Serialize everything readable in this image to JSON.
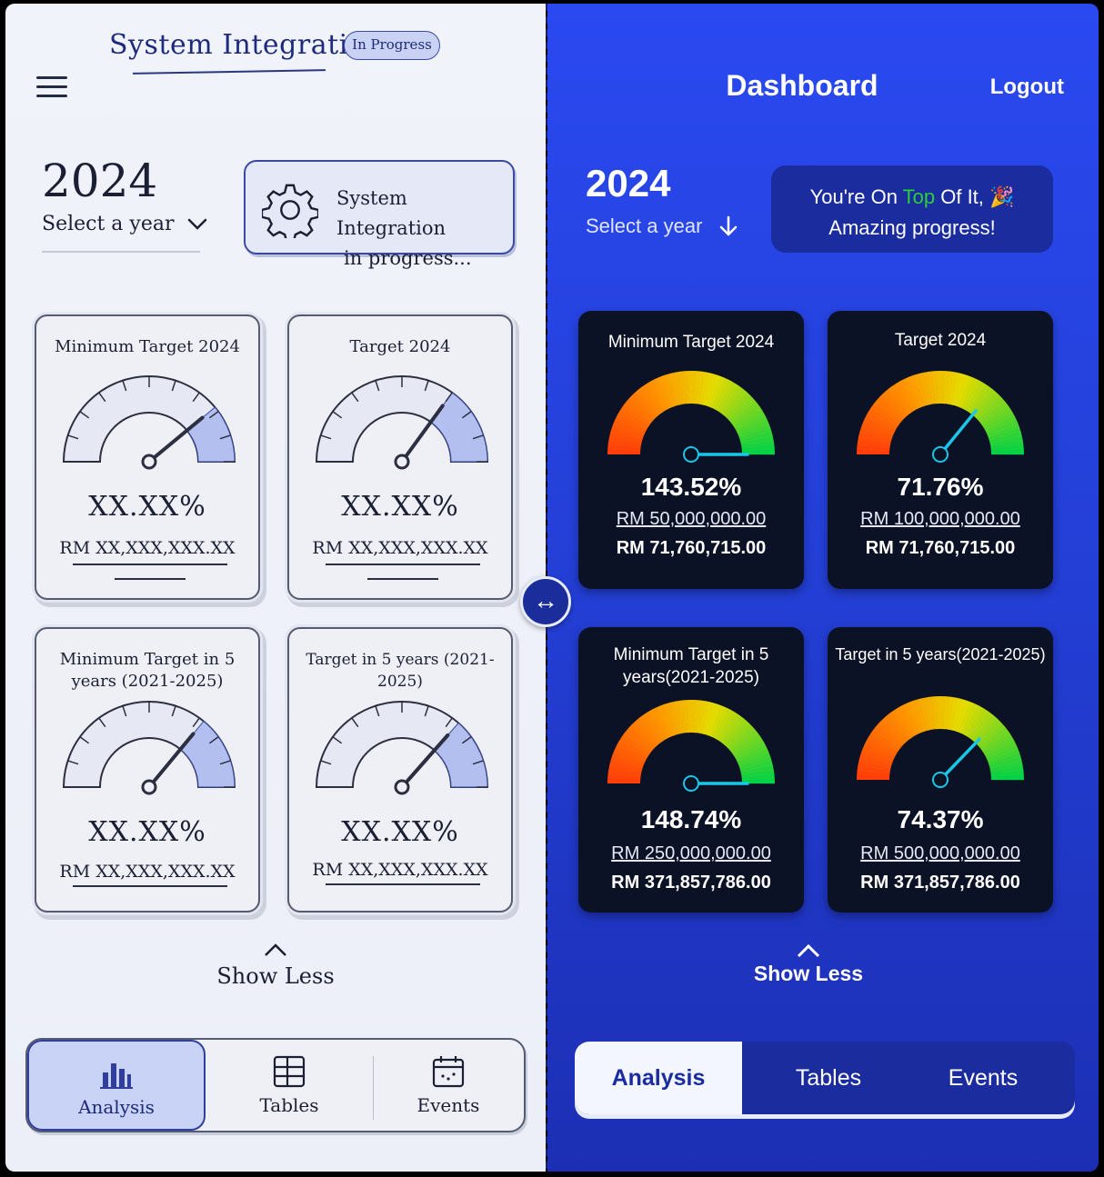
{
  "left": {
    "title": "System Integration",
    "badge": "In Progress",
    "year": "2024",
    "select_label": "Select a year",
    "progress_line1": "System Integration",
    "progress_line2": "in progress...",
    "cards": [
      {
        "title": "Minimum Target 2024",
        "percent": "XX.XX%",
        "amount": "RM XX,XXX,XXX.XX",
        "level": 0.78
      },
      {
        "title": "Target 2024",
        "percent": "XX.XX%",
        "amount": "RM XX,XXX,XXX.XX",
        "level": 0.7
      },
      {
        "title_line1": "Minimum Target in 5",
        "title_line2": "years (2021-2025)",
        "percent": "XX.XX%",
        "amount": "RM XX,XXX,XXX.XX",
        "level": 0.72
      },
      {
        "title": "Target in 5 years (2021-2025)",
        "percent": "XX.XX%",
        "amount": "RM XX,XXX,XXX.XX",
        "level": 0.73
      }
    ],
    "show_less": "Show Less",
    "tabs": [
      "Analysis",
      "Tables",
      "Events"
    ],
    "active_tab": "Analysis"
  },
  "right": {
    "title": "Dashboard",
    "logout": "Logout",
    "year": "2024",
    "select_label": "Select a year",
    "banner_pre": "You're On ",
    "banner_top": "Top",
    "banner_post": " Of It, 🎉",
    "banner_line2": "Amazing progress!",
    "cards": [
      {
        "title": "Minimum Target 2024",
        "percent": "143.52%",
        "target": "RM 50,000,000.00",
        "actual": "RM 71,760,715.00",
        "value": 143.52
      },
      {
        "title": "Target 2024",
        "percent": "71.76%",
        "target": "RM 100,000,000.00",
        "actual": "RM 71,760,715.00",
        "value": 71.76
      },
      {
        "title_line1": "Minimum Target in 5",
        "title_line2": "years(2021-2025)",
        "percent": "148.74%",
        "target": "RM 250,000,000.00",
        "actual": "RM 371,857,786.00",
        "value": 148.74
      },
      {
        "title": "Target in 5 years(2021-2025)",
        "percent": "74.37%",
        "target": "RM 500,000,000.00",
        "actual": "RM 371,857,786.00",
        "value": 74.37
      }
    ],
    "show_less": "Show Less",
    "tabs": [
      "Analysis",
      "Tables",
      "Events"
    ],
    "active_tab": "Analysis"
  },
  "colors": {
    "right_bg": "#2a49f0",
    "card_bg": "#0b1226",
    "needle": "#19c8e8",
    "top_word": "#2bcf3a",
    "sketch_ink": "#1e2a7a"
  }
}
